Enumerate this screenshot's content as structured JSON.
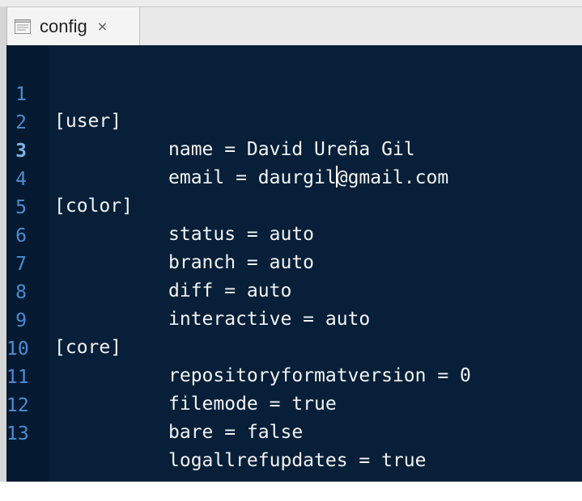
{
  "tab": {
    "icon": "text-file-icon",
    "title": "config",
    "close_label": "×"
  },
  "editor": {
    "lines": [
      {
        "number": "1",
        "text": "[user]"
      },
      {
        "number": "2",
        "text": "name = David Ureña Gil"
      },
      {
        "number": "3",
        "text_before_caret": "email = daurgil",
        "text_after_caret": "@gmail.com"
      },
      {
        "number": "4",
        "text": "[color]"
      },
      {
        "number": "5",
        "text": "status = auto"
      },
      {
        "number": "6",
        "text": "branch = auto"
      },
      {
        "number": "7",
        "text": "diff = auto"
      },
      {
        "number": "8",
        "text": "interactive = auto"
      },
      {
        "number": "9",
        "text": "[core]"
      },
      {
        "number": "10",
        "text": "repositoryformatversion = 0"
      },
      {
        "number": "11",
        "text": "filemode = true"
      },
      {
        "number": "12",
        "text": "bare = false"
      },
      {
        "number": "13",
        "text": "logallrefupdates = true"
      }
    ],
    "active_line": "3"
  },
  "colors": {
    "editor_background": "#071f38",
    "line_number": "#4b8dd3",
    "code_text": "#f3f3f3"
  }
}
